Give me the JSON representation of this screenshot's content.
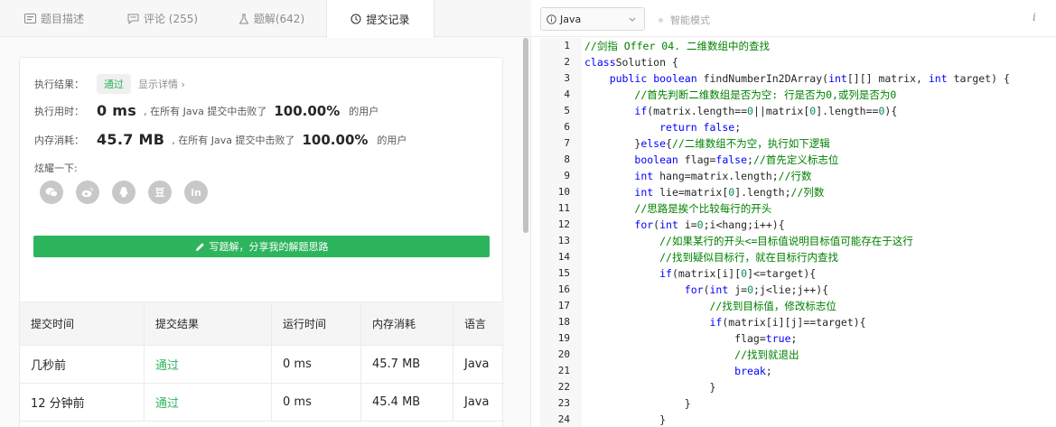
{
  "tabs": [
    {
      "label": "题目描述",
      "icon": "description-icon"
    },
    {
      "label": "评论 (255)",
      "icon": "comment-icon"
    },
    {
      "label": "题解(642)",
      "icon": "flask-icon"
    },
    {
      "label": "提交记录",
      "icon": "clock-icon",
      "active": true
    }
  ],
  "result": {
    "result_label": "执行结果：",
    "status": "通过",
    "details_link": "显示详情 ›",
    "time_label": "执行用时：",
    "time_value": "0 ms",
    "time_mid": ", 在所有 Java 提交中击败了",
    "time_pct": "100.00%",
    "time_suffix": "的用户",
    "mem_label": "内存消耗：",
    "mem_value": "45.7 MB",
    "mem_mid": ", 在所有 Java 提交中击败了",
    "mem_pct": "100.00%",
    "mem_suffix": "的用户",
    "share_label": "炫耀一下:",
    "share_icons": [
      "wechat-icon",
      "weibo-icon",
      "qq-icon",
      "douban-icon",
      "linkedin-icon"
    ],
    "share_glyphs": [
      "",
      "",
      "",
      "豆",
      "in"
    ],
    "write_button": "写题解，分享我的解题思路"
  },
  "submissions": {
    "headers": [
      "提交时间",
      "提交结果",
      "运行时间",
      "内存消耗",
      "语言"
    ],
    "rows": [
      [
        "几秒前",
        "通过",
        "0 ms",
        "45.7 MB",
        "Java"
      ],
      [
        "12 分钟前",
        "通过",
        "0 ms",
        "45.4 MB",
        "Java"
      ]
    ]
  },
  "toolbar": {
    "language": "Java",
    "smart_mode": "智能模式",
    "info": "i"
  },
  "colors": {
    "accent_green": "#2db55d",
    "keyword_blue": "#0000ff",
    "comment_green": "#008000",
    "number_green": "#09885a"
  },
  "code": {
    "line_numbers": [
      "1",
      "2",
      "3",
      "4",
      "5",
      "6",
      "7",
      "8",
      "9",
      "10",
      "11",
      "12",
      "13",
      "14",
      "15",
      "16",
      "17",
      "18",
      "19",
      "20",
      "21",
      "22",
      "23",
      "24"
    ],
    "lines": [
      [
        [
          "cm",
          "//剑指 Offer 04. 二维数组中的查找"
        ]
      ],
      [
        [
          "kw",
          "class"
        ],
        [
          "",
          "Solution {"
        ]
      ],
      [
        [
          "",
          "    "
        ],
        [
          "kw",
          "public"
        ],
        [
          "",
          "",
          " "
        ],
        [
          "kw",
          "boolean"
        ],
        [
          "",
          " findNumberIn2DArray("
        ],
        [
          "ty",
          "int"
        ],
        [
          "",
          "[][] matrix, "
        ],
        [
          "ty",
          "int"
        ],
        [
          "",
          " target) {"
        ]
      ],
      [
        [
          "",
          "        "
        ],
        [
          "cm",
          "//首先判断二维数组是否为空: 行是否为0,或列是否为0"
        ]
      ],
      [
        [
          "",
          "        "
        ],
        [
          "kw",
          "if"
        ],
        [
          "",
          "(matrix.length=="
        ],
        [
          "num",
          "0"
        ],
        [
          "",
          "||matrix["
        ],
        [
          "num",
          "0"
        ],
        [
          "",
          "].length=="
        ],
        [
          "num",
          "0"
        ],
        [
          "",
          "){"
        ]
      ],
      [
        [
          "",
          "            "
        ],
        [
          "kw",
          "return false"
        ],
        [
          "",
          ";"
        ]
      ],
      [
        [
          "",
          "        }"
        ],
        [
          "kw",
          "else"
        ],
        [
          "",
          "{"
        ],
        [
          "cm",
          "//二维数组不为空，执行如下逻辑"
        ]
      ],
      [
        [
          "",
          "        "
        ],
        [
          "ty",
          "boolean"
        ],
        [
          "",
          " flag="
        ],
        [
          "kw",
          "false"
        ],
        [
          "",
          ";"
        ],
        [
          "cm",
          "//首先定义标志位"
        ]
      ],
      [
        [
          "",
          "        "
        ],
        [
          "ty",
          "int"
        ],
        [
          "",
          " hang=matrix.length;"
        ],
        [
          "cm",
          "//行数"
        ]
      ],
      [
        [
          "",
          "        "
        ],
        [
          "ty",
          "int"
        ],
        [
          "",
          " lie=matrix["
        ],
        [
          "num",
          "0"
        ],
        [
          "",
          "].length;"
        ],
        [
          "cm",
          "//列数"
        ]
      ],
      [
        [
          "",
          "        "
        ],
        [
          "cm",
          "//思路是挨个比较每行的开头"
        ]
      ],
      [
        [
          "",
          "        "
        ],
        [
          "kw",
          "for"
        ],
        [
          "",
          "("
        ],
        [
          "ty",
          "int"
        ],
        [
          "",
          " i="
        ],
        [
          "num",
          "0"
        ],
        [
          "",
          ";i<hang;i++){"
        ]
      ],
      [
        [
          "",
          "            "
        ],
        [
          "cm",
          "//如果某行的开头<=目标值说明目标值可能存在于这行"
        ]
      ],
      [
        [
          "",
          "            "
        ],
        [
          "cm",
          "//找到疑似目标行，就在目标行内查找"
        ]
      ],
      [
        [
          "",
          "            "
        ],
        [
          "kw",
          "if"
        ],
        [
          "",
          "(matrix[i]["
        ],
        [
          "num",
          "0"
        ],
        [
          "",
          "]<=target){"
        ]
      ],
      [
        [
          "",
          "                "
        ],
        [
          "kw",
          "for"
        ],
        [
          "",
          "("
        ],
        [
          "ty",
          "int"
        ],
        [
          "",
          " j="
        ],
        [
          "num",
          "0"
        ],
        [
          "",
          ";j<lie;j++){"
        ]
      ],
      [
        [
          "",
          "                    "
        ],
        [
          "cm",
          "//找到目标值，修改标志位"
        ]
      ],
      [
        [
          "",
          "                    "
        ],
        [
          "kw",
          "if"
        ],
        [
          "",
          "(matrix[i][j]==target){"
        ]
      ],
      [
        [
          "",
          "                        flag="
        ],
        [
          "kw",
          "true"
        ],
        [
          "",
          ";"
        ]
      ],
      [
        [
          "",
          "                        "
        ],
        [
          "cm",
          "//找到就退出"
        ]
      ],
      [
        [
          "",
          "                        "
        ],
        [
          "kw",
          "break"
        ],
        [
          "",
          ";"
        ]
      ],
      [
        [
          "",
          "                    }"
        ]
      ],
      [
        [
          "",
          "                }"
        ]
      ],
      [
        [
          "",
          "            }"
        ]
      ]
    ]
  }
}
